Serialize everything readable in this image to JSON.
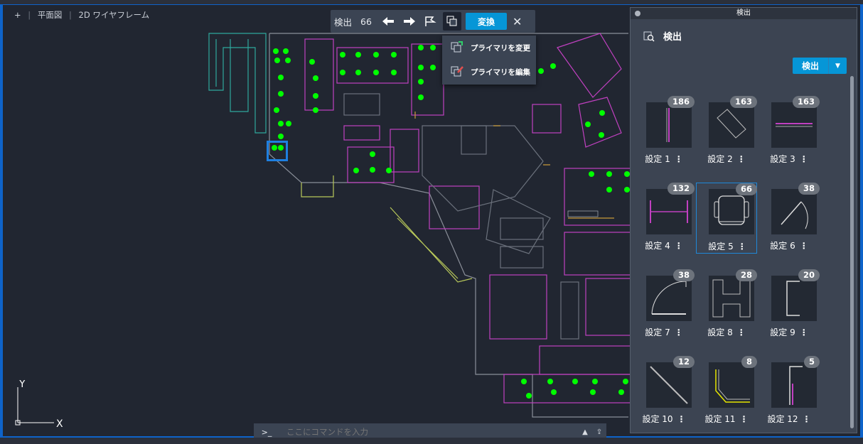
{
  "viewport": {
    "label_plus": "+",
    "label_view": "平面図",
    "label_style": "2D ワイヤフレーム"
  },
  "findbar": {
    "label": "検出",
    "count": "66",
    "convert_label": "変換",
    "close_glyph": "✕"
  },
  "dropdown": {
    "items": [
      {
        "label": "プライマリを変更",
        "icon": "change-primary-icon"
      },
      {
        "label": "プライマリを編集",
        "icon": "edit-primary-icon"
      }
    ]
  },
  "panel": {
    "title": "検出",
    "header": "検出",
    "find_button": "検出",
    "cards": [
      {
        "label": "設定 1",
        "count": "186",
        "shape": "vertical-line"
      },
      {
        "label": "設定 2",
        "count": "163",
        "shape": "rotated-rect"
      },
      {
        "label": "設定 3",
        "count": "163",
        "shape": "horizontal-lines"
      },
      {
        "label": "設定 4",
        "count": "132",
        "shape": "i-beam"
      },
      {
        "label": "設定 5",
        "count": "66",
        "shape": "chair",
        "selected": true
      },
      {
        "label": "設定 6",
        "count": "38",
        "shape": "door-swing"
      },
      {
        "label": "設定 7",
        "count": "38",
        "shape": "door-arc"
      },
      {
        "label": "設定 8",
        "count": "28",
        "shape": "h-shape"
      },
      {
        "label": "設定 9",
        "count": "20",
        "shape": "bracket"
      },
      {
        "label": "設定 10",
        "count": "12",
        "shape": "diagonal"
      },
      {
        "label": "設定 11",
        "count": "8",
        "shape": "corner"
      },
      {
        "label": "設定 12",
        "count": "5",
        "shape": "wall-corner"
      }
    ]
  },
  "cmdline": {
    "prompt": ">_",
    "placeholder": "ここにコマンドを入力"
  },
  "ucs": {
    "y": "Y",
    "x": "X"
  },
  "colors": {
    "accent": "#0696d7",
    "selection": "#1e7fe0",
    "highlight_green": "#00ff00",
    "wall_magenta": "#c040c0",
    "wall_teal": "#2fa89c"
  }
}
